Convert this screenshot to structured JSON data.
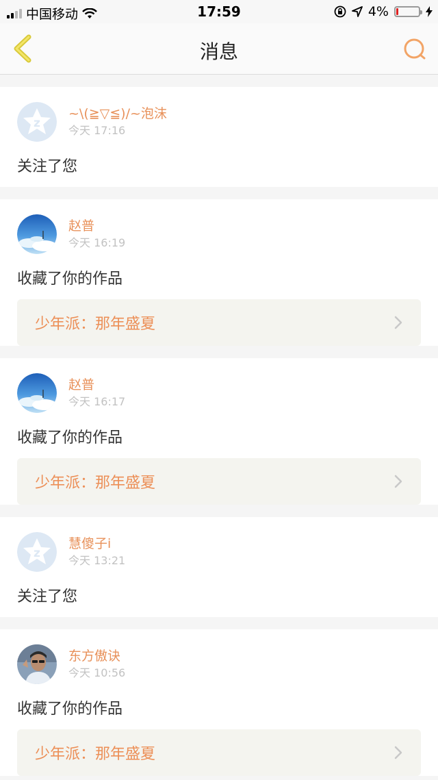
{
  "status_bar": {
    "carrier": "中国移动",
    "time": "17:59",
    "battery_percent": "4%"
  },
  "nav": {
    "title": "消息"
  },
  "messages": [
    {
      "name": "~\\(≧▽≦)/~泡沫",
      "time": "今天 17:16",
      "action": "关注了您",
      "avatar": "default-avatar"
    },
    {
      "name": "赵普",
      "time": "今天 16:19",
      "action": "收藏了你的作品",
      "work": "少年派：那年盛夏",
      "avatar": "sky-photo-avatar"
    },
    {
      "name": "赵普",
      "time": "今天 16:17",
      "action": "收藏了你的作品",
      "work": "少年派：那年盛夏",
      "avatar": "sky-photo-avatar"
    },
    {
      "name": "慧傻子i",
      "time": "今天 13:21",
      "action": "关注了您",
      "avatar": "default-avatar"
    },
    {
      "name": "东方傲诀",
      "time": "今天 10:56",
      "action": "收藏了你的作品",
      "work": "少年派：那年盛夏",
      "avatar": "person-photo-avatar"
    }
  ],
  "colors": {
    "accent": "#e8915a",
    "back_icon": "#e0d23a",
    "search_icon": "#f0a060"
  }
}
